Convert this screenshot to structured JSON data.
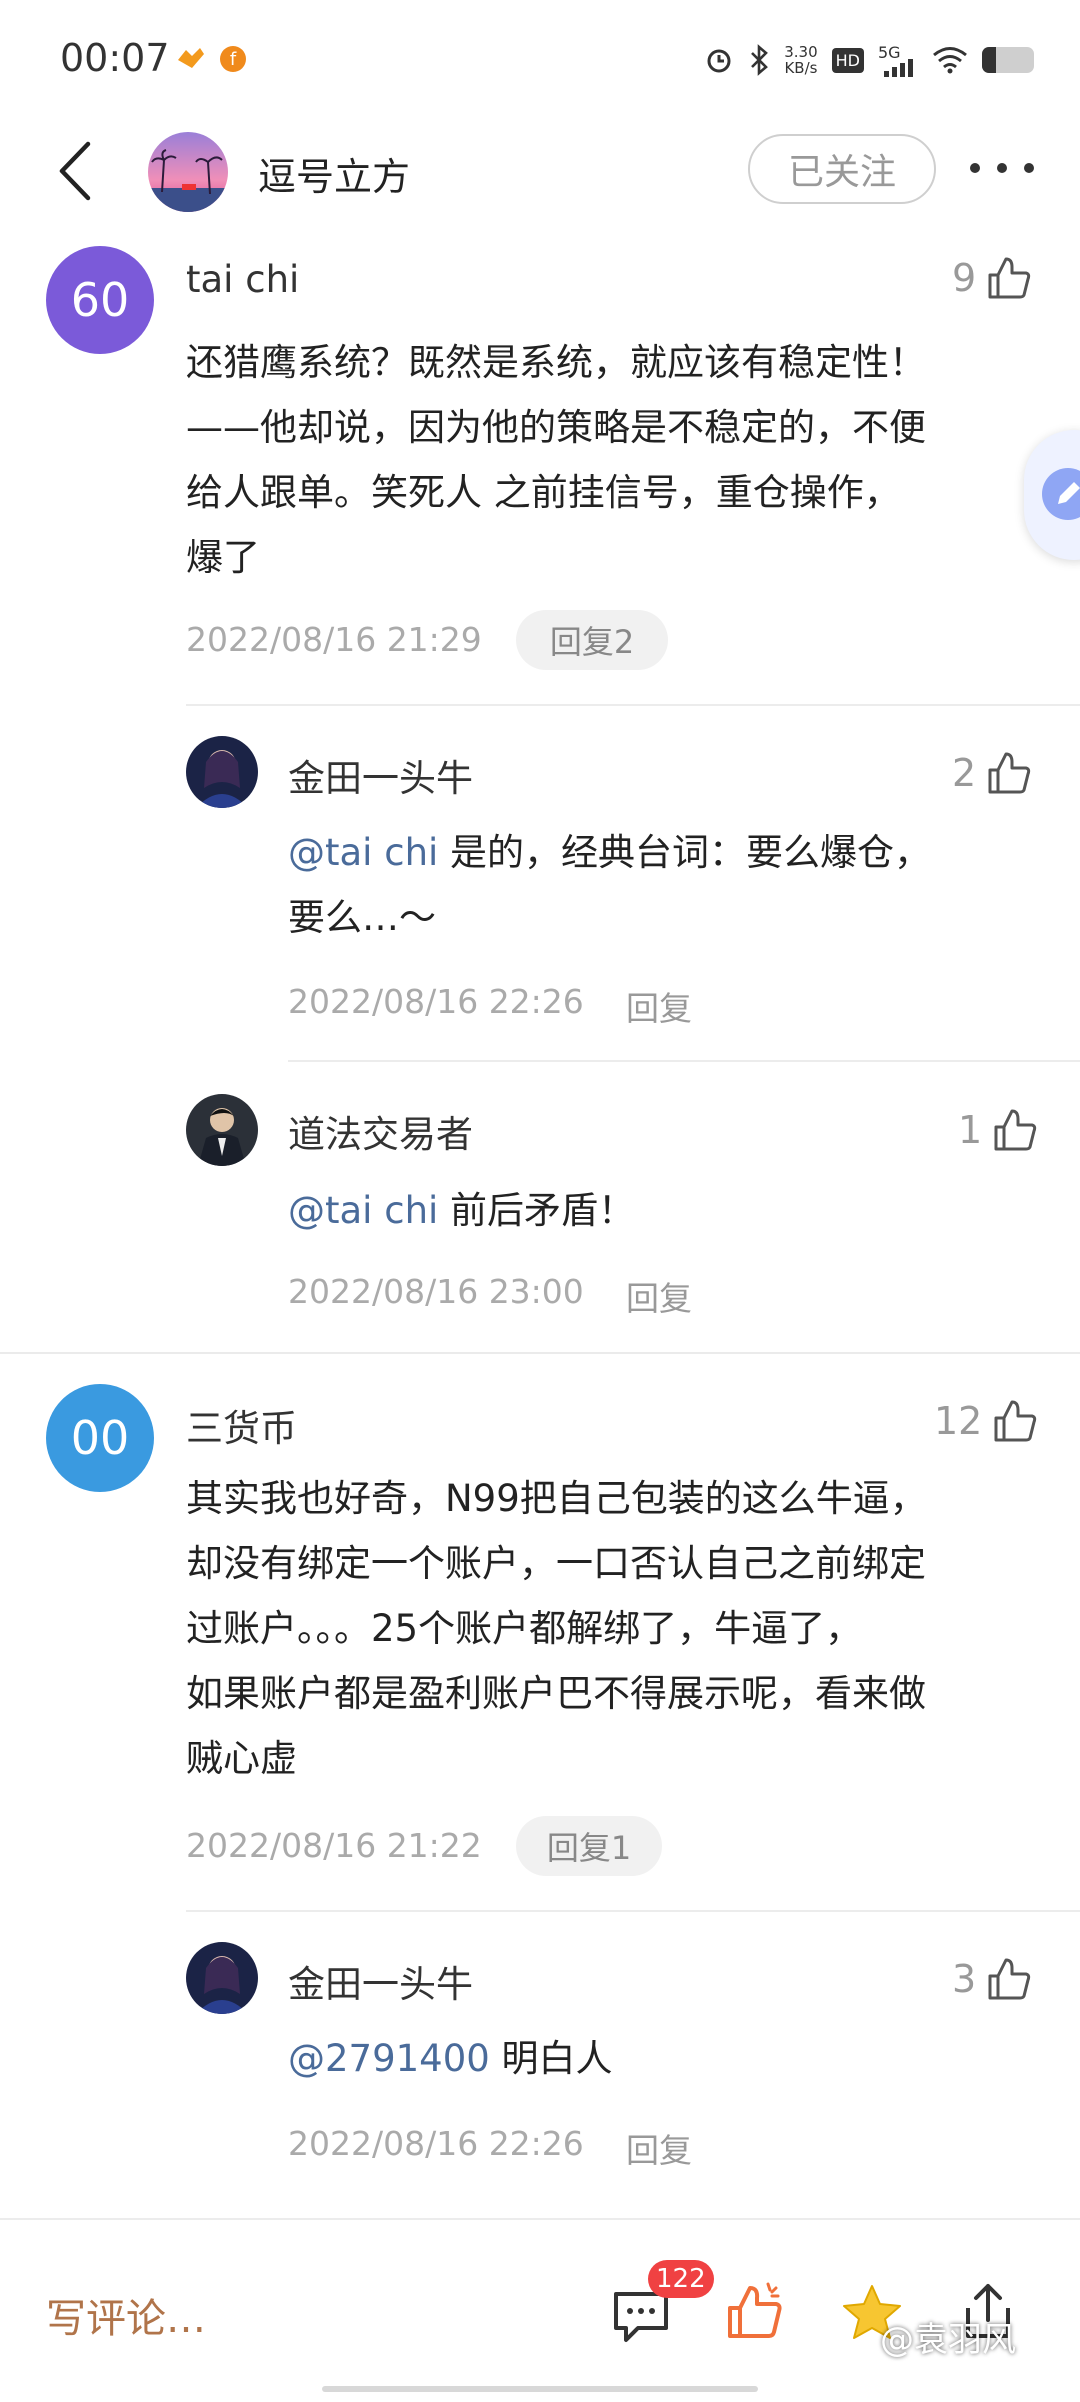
{
  "status_bar": {
    "time": "00:07",
    "net_speed_value": "3.30",
    "net_speed_unit": "KB/s",
    "hd": "HD",
    "network": "5G",
    "icons": [
      "notification-icon-1",
      "notification-icon-2",
      "alarm-icon",
      "bluetooth-icon",
      "signal-icon",
      "wifi-icon",
      "battery-icon"
    ]
  },
  "header": {
    "title": "逗号立方",
    "follow_label": "已关注",
    "icons": [
      "back-arrow-icon",
      "more-dots-icon"
    ]
  },
  "comments": [
    {
      "avatar_text": "60",
      "avatar_color": "#7b5ad9",
      "user": "tai chi",
      "likes": "9",
      "text": "还猎鹰系统？既然是系统，就应该有稳定性！——他却说，因为他的策略是不稳定的，不便给人跟单。笑死人 之前挂信号，重仓操作，爆了",
      "lines": [
        "还猎鹰系统？既然是系统，就应该有稳定性！",
        "——他却说，因为他的策略是不稳定的，不便",
        "给人跟单。笑死人 之前挂信号，重仓操作，",
        "爆了"
      ],
      "date": "2022/08/16 21:29",
      "reply_label": "回复2",
      "replies": [
        {
          "user": "金田一头牛",
          "likes": "2",
          "mention": "@tai chi",
          "text_line1": " 是的，经典台词：要么爆仓，",
          "text_line2": "要么…～",
          "date": "2022/08/16 22:26",
          "reply_label": "回复"
        },
        {
          "user": "道法交易者",
          "likes": "1",
          "mention": "@tai chi",
          "text_line1": " 前后矛盾！",
          "date": "2022/08/16 23:00",
          "reply_label": "回复"
        }
      ]
    },
    {
      "avatar_text": "00",
      "avatar_color": "#3a9ae0",
      "user": "三货币",
      "likes": "12",
      "lines": [
        "其实我也好奇，N99把自己包装的这么牛逼，",
        "却没有绑定一个账户，一口否认自己之前绑定",
        "过账户。。。25个账户都解绑了，牛逼了，",
        "如果账户都是盈利账户巴不得展示呢，看来做",
        "贼心虚"
      ],
      "date": "2022/08/16 21:22",
      "reply_label": "回复1",
      "replies": [
        {
          "user": "金田一头牛",
          "likes": "3",
          "mention": "@2791400",
          "text_line1": " 明白人",
          "date": "2022/08/16 22:26",
          "reply_label": "回复"
        }
      ]
    }
  ],
  "bottom_bar": {
    "write_placeholder": "写评论…",
    "comment_count": "122",
    "watermark": "@袁羽风",
    "icons": [
      "comment-icon",
      "like-icon",
      "star-icon",
      "share-icon"
    ]
  },
  "colors": {
    "accent_write": "#b0744a",
    "mention": "#4a6b9a",
    "badge": "#f04142"
  }
}
